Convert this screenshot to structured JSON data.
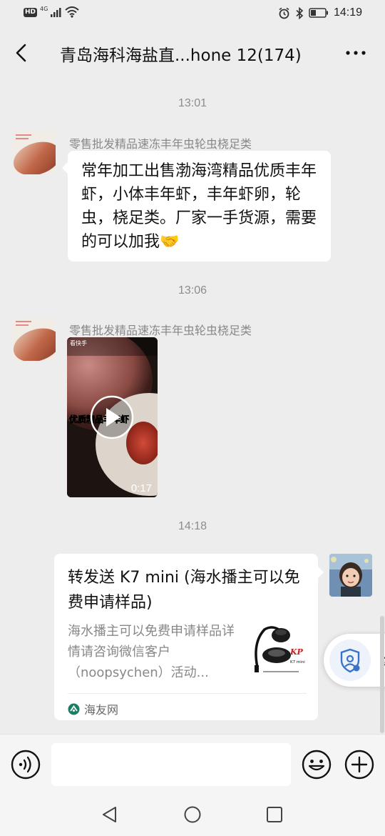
{
  "status_bar": {
    "left_badge": "HD",
    "signal_label": "4G",
    "time": "14:19"
  },
  "header": {
    "title": "青岛海科海盐直...hone 12(174)",
    "back_icon": "chevron-left-icon",
    "more_icon": "ellipsis-icon"
  },
  "messages": [
    {
      "timestamp": "13:01",
      "sender": "零售批发精品速冻丰年虫轮虫桡足类",
      "type": "text",
      "text": "常年加工出售渤海湾精品优质丰年虾，小体丰年虾，丰年虾卵，轮虫，桡足类。厂家一手货源，需要的可以加我🤝"
    },
    {
      "timestamp": "13:06",
      "sender": "零售批发精品速冻丰年虫轮虫桡足类",
      "type": "video",
      "video_caption": "优质精品丰年虾",
      "video_logo_text": "看快手",
      "duration": "0:17"
    },
    {
      "timestamp": "14:18",
      "sender": "me",
      "type": "link_card",
      "card_title": "转发送 K7 mini (海水播主可以免费申请样品)",
      "card_description": "海水播主可以免费申请样品详情请咨询微信客户（noopsychen）活动...",
      "card_source": "海友网",
      "card_thumb_brand": "KP",
      "card_thumb_model": "K7 mini"
    }
  ],
  "floating_widget": {
    "icon": "shield-person-icon",
    "label": "隐"
  },
  "input_bar": {
    "voice_icon": "voice-icon",
    "emoji_icon": "emoji-icon",
    "plus_icon": "plus-icon",
    "placeholder": ""
  },
  "system_nav": {
    "back_icon": "triangle-back-icon",
    "home_icon": "circle-home-icon",
    "recents_icon": "square-recents-icon"
  },
  "colors": {
    "background": "#ededed",
    "bubble": "#ffffff",
    "timestamp": "#8c8c8c"
  }
}
